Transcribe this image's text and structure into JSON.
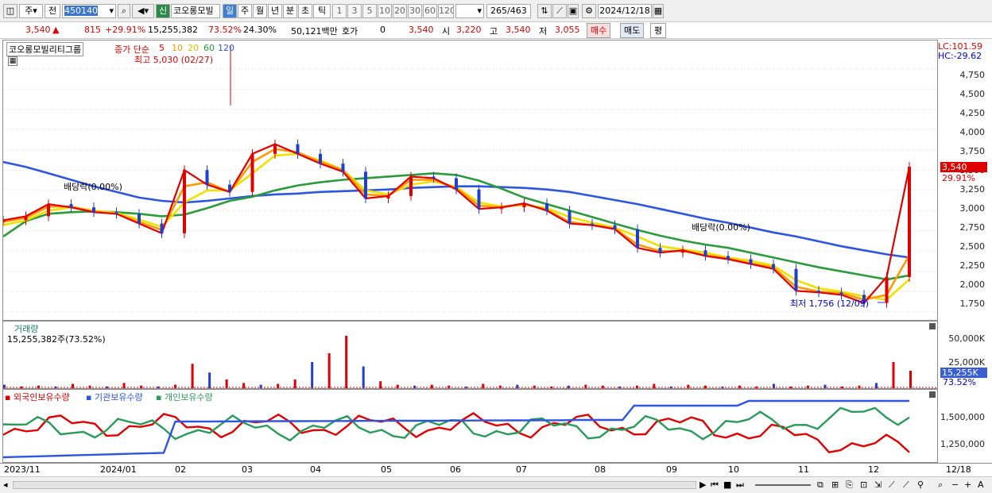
{
  "toolbar": {
    "type_select": "주",
    "prev_label": "전",
    "stock_code": "450140",
    "stock_name": "코오롱모빌",
    "new_badge": "신",
    "periods": [
      "일",
      "주",
      "월",
      "년",
      "분",
      "초",
      "틱"
    ],
    "intervals": [
      "1",
      "3",
      "5",
      "10",
      "20",
      "30",
      "60",
      "120"
    ],
    "count_value": "265",
    "count_total": "/463",
    "date": "2024/12/18"
  },
  "quote": {
    "price": "3,540",
    "arrow": "▲",
    "change": "815",
    "change_pct": "+29.91%",
    "volume": "15,255,382",
    "vol_ratio": "73.52%",
    "turnover": "24.30%",
    "amount": "50,121백만",
    "hoga_label": "호가",
    "hoga_value": "0",
    "hoga_price": "3,540",
    "open_label": "시",
    "open": "3,220",
    "high_label": "고",
    "high": "3,540",
    "low_label": "저",
    "low": "3,055",
    "buy_btn": "매수",
    "sell_btn": "매도",
    "avg_btn": "평"
  },
  "price_pane": {
    "title": "코오롱모빌리티그룹",
    "ma_label": "종가 단순",
    "ma_periods": [
      "5",
      "10",
      "20",
      "60",
      "120"
    ],
    "ma_colors": [
      "#e00000",
      "#ff9900",
      "#f0e000",
      "#2a9a3a",
      "#2e55e0"
    ],
    "high_note": "최고 5,030 (02/27)",
    "low_note": "최저 1,756 (12/09)",
    "div_note_1": "배당락(0.00%)",
    "div_note_2": "배당락(0.00%)",
    "lc": "LC:101.59",
    "hc": "HC:-29.62",
    "ticks": [
      "4,750",
      "4,500",
      "4,250",
      "4,000",
      "3,750",
      "3,500",
      "3,250",
      "3,000",
      "2,750",
      "2,500",
      "2,250",
      "2,000",
      "1,750"
    ],
    "price_tag": "3,540",
    "pct_tag": "29.91%"
  },
  "volume_pane": {
    "title": "거래량",
    "value": "15,255,382주(73.52%)",
    "ticks": [
      "50,000K",
      "25,000K"
    ],
    "vol_tag": "15,255K",
    "pct_tag": "73.52%"
  },
  "holdings_pane": {
    "legend": [
      {
        "label": "외국인보유수량",
        "color": "#e00000"
      },
      {
        "label": "기관보유수량",
        "color": "#2e55e0"
      },
      {
        "label": "개인보유수량",
        "color": "#2a9a5a"
      }
    ],
    "ticks": [
      "1,500,000",
      "1,250,000"
    ]
  },
  "x_axis": {
    "labels": [
      "2023/11",
      "2024/01",
      "02",
      "03",
      "04",
      "05",
      "06",
      "07",
      "08",
      "09",
      "10",
      "11",
      "12"
    ],
    "end_label": "12/18"
  },
  "chart_data": {
    "type": "line",
    "title": "코오롱모빌리티그룹",
    "y_range": [
      1650,
      5100
    ],
    "price_extremes": {
      "high": 5030,
      "high_date": "02/27",
      "low": 1756,
      "low_date": "12/09"
    },
    "last": {
      "close": 3540,
      "open": 3220,
      "high": 3540,
      "low": 3055
    },
    "series": [
      {
        "name": "5",
        "values": [
          2880,
          2930,
          3080,
          3040,
          2980,
          2960,
          2840,
          2720,
          3500,
          3320,
          3230,
          3700,
          3820,
          3700,
          3580,
          3480,
          3150,
          3180,
          3420,
          3400,
          3260,
          3020,
          3040,
          3090,
          3000,
          2840,
          2820,
          2770,
          2540,
          2480,
          2510,
          2440,
          2400,
          2340,
          2280,
          2010,
          1990,
          1960,
          1860,
          2180,
          3540
        ]
      },
      {
        "name": "10",
        "values": [
          2860,
          2910,
          3050,
          3050,
          2990,
          2960,
          2860,
          2760,
          3300,
          3350,
          3230,
          3600,
          3760,
          3720,
          3600,
          3500,
          3200,
          3180,
          3380,
          3380,
          3280,
          3060,
          3040,
          3080,
          3010,
          2860,
          2820,
          2780,
          2580,
          2500,
          2500,
          2450,
          2410,
          2350,
          2300,
          2060,
          2000,
          1980,
          1900,
          1960,
          2450
        ]
      },
      {
        "name": "20",
        "values": [
          2820,
          2880,
          3000,
          3040,
          3000,
          2970,
          2890,
          2800,
          3100,
          3250,
          3250,
          3460,
          3680,
          3700,
          3620,
          3500,
          3250,
          3200,
          3320,
          3360,
          3290,
          3100,
          3050,
          3070,
          3030,
          2920,
          2850,
          2790,
          2680,
          2560,
          2520,
          2480,
          2420,
          2380,
          2320,
          2140,
          2040,
          2000,
          1940,
          1900,
          2150
        ]
      },
      {
        "name": "60",
        "values": [
          2680,
          2870,
          2960,
          2980,
          2990,
          2980,
          2960,
          2930,
          2950,
          3030,
          3120,
          3170,
          3250,
          3310,
          3350,
          3380,
          3400,
          3420,
          3440,
          3460,
          3440,
          3370,
          3270,
          3160,
          3080,
          3000,
          2920,
          2840,
          2760,
          2690,
          2630,
          2580,
          2540,
          2480,
          2420,
          2360,
          2300,
          2250,
          2200,
          2150,
          2200
        ]
      },
      {
        "name": "120",
        "values": [
          3600,
          3540,
          3460,
          3380,
          3300,
          3230,
          3160,
          3120,
          3100,
          3120,
          3150,
          3180,
          3200,
          3210,
          3230,
          3240,
          3250,
          3260,
          3280,
          3290,
          3300,
          3300,
          3290,
          3280,
          3260,
          3230,
          3180,
          3130,
          3080,
          3020,
          2960,
          2900,
          2850,
          2790,
          2730,
          2680,
          2620,
          2560,
          2510,
          2460,
          2420
        ]
      }
    ]
  }
}
